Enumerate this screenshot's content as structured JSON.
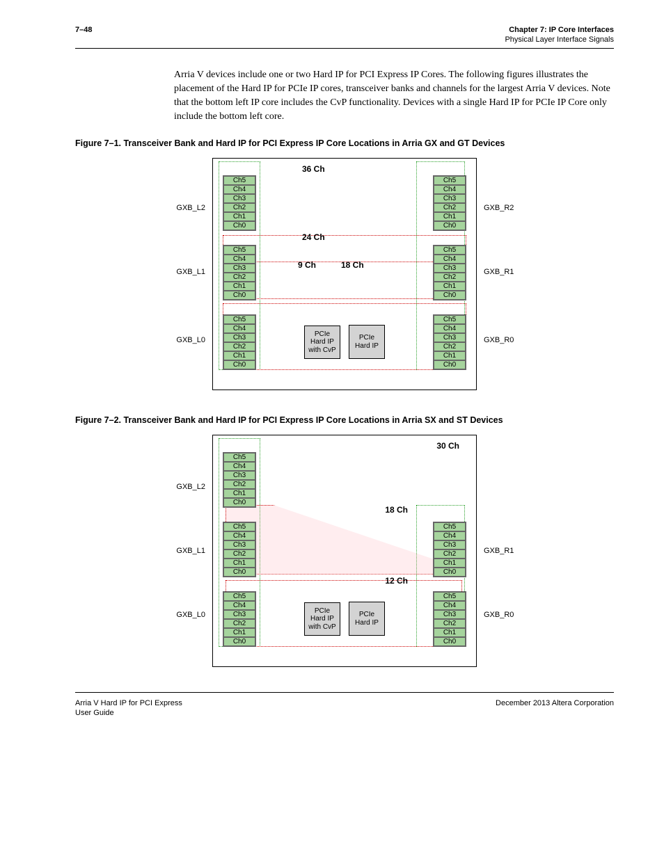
{
  "header": {
    "page_num": "7–48",
    "chapter": "Chapter 7:  IP Core Interfaces",
    "section": "Physical Layer Interface Signals"
  },
  "body": {
    "para": "Arria V devices include one or two Hard IP for PCI Express IP Cores. The following figures illustrates the placement of the Hard IP for PCIe IP cores, transceiver banks and channels for the largest Arria V devices. Note that the bottom left IP core includes the CvP functionality. Devices with a single Hard IP for PCIe IP Core only include the bottom left core."
  },
  "fig1": {
    "caption": "Figure 7–1.  Transceiver Bank and Hard IP for PCI Express IP Core Locations in Arria GX and GT Devices",
    "labels": {
      "l2": "GXB_L2",
      "l1": "GXB_L1",
      "l0": "GXB_L0",
      "r2": "GXB_R2",
      "r1": "GXB_R1",
      "r0": "GXB_R0",
      "c36": "36 Ch",
      "c24": "24 Ch",
      "c18": "18 Ch",
      "c9": "9 Ch"
    },
    "pcie_left": "PCIe Hard IP with CvP",
    "pcie_right": "PCIe Hard IP"
  },
  "fig2": {
    "caption": "Figure 7–2.  Transceiver Bank and Hard IP for PCI Express IP Core Locations in Arria SX and ST Devices",
    "labels": {
      "l2": "GXB_L2",
      "l1": "GXB_L1",
      "l0": "GXB_L0",
      "r1": "GXB_R1",
      "r0": "GXB_R0",
      "c30": "30 Ch",
      "c18": "18 Ch",
      "c12": "12 Ch"
    },
    "pcie_left": "PCIe Hard IP with CvP",
    "pcie_right": "PCIe Hard IP"
  },
  "channels": [
    "Ch5",
    "Ch4",
    "Ch3",
    "Ch2",
    "Ch1",
    "Ch0"
  ],
  "footer": {
    "left1": "Arria V Hard IP for PCI Express",
    "left2": "User Guide",
    "right": "December 2013   Altera Corporation"
  }
}
